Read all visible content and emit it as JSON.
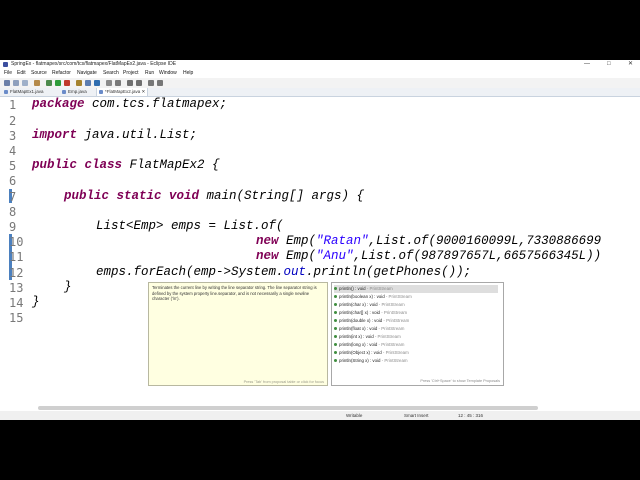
{
  "window": {
    "title": "SpringEx - flatmapex/src/com/tcs/flatmapex/FlatMapEx2.java - Eclipse IDE",
    "minimize": "—",
    "maximize": "□",
    "close": "✕"
  },
  "menu": [
    "File",
    "Edit",
    "Source",
    "Refactor",
    "Navigate",
    "Search",
    "Project",
    "Run",
    "Window",
    "Help"
  ],
  "tabs": [
    {
      "label": "FlatMapEx1.java",
      "active": false
    },
    {
      "label": "Emp.java",
      "active": false
    },
    {
      "label": "*FlatMapEx2.java ✕",
      "active": true
    }
  ],
  "code": {
    "line_numbers": [
      "1",
      "2",
      "3",
      "4",
      "5",
      "6",
      "7",
      "8",
      "9",
      "10",
      "11",
      "12",
      "13",
      "14",
      "15"
    ],
    "l1_kw": "package",
    "l1_rest": " com.tcs.flatmapex;",
    "l3_kw": "import",
    "l3_rest": " java.util.List;",
    "l5_kw": "public class",
    "l5_rest": " FlatMapEx2 {",
    "l7_kw": "public static void",
    "l7_rest": " main(String[] args) {",
    "l9": "List<Emp> emps = List.of(",
    "l10_kw": "new",
    "l10_a": " Emp(",
    "l10_str": "\"Ratan\"",
    "l10_b": ",List.of(9000160099L,7330886699",
    "l11_kw": "new",
    "l11_a": " Emp(",
    "l11_str": "\"Anu\"",
    "l11_b": ",List.of(987897657L,6657566345L))",
    "l12_a": "emps.forEach(emp->System.",
    "l12_fld": "out",
    "l12_b": ".println(getPhones());",
    "l13": "}",
    "l14": "}"
  },
  "javadoc": {
    "text": "Terminates the current line by writing the line separator string. The line separator string is defined by the system property line.separator, and is not necessarily a single newline character ('\\n').",
    "footer": "Press 'Tab' from proposal table or click for focus"
  },
  "proposals": {
    "items": [
      {
        "sig": "println() : void",
        "type": " - PrintStream"
      },
      {
        "sig": "println(boolean x) : void",
        "type": " - PrintStream"
      },
      {
        "sig": "println(char x) : void",
        "type": " - PrintStream"
      },
      {
        "sig": "println(char[] x) : void",
        "type": " - PrintStream"
      },
      {
        "sig": "println(double x) : void",
        "type": " - PrintStream"
      },
      {
        "sig": "println(float x) : void",
        "type": " - PrintStream"
      },
      {
        "sig": "println(int x) : void",
        "type": " - PrintStream"
      },
      {
        "sig": "println(long x) : void",
        "type": " - PrintStream"
      },
      {
        "sig": "println(Object x) : void",
        "type": " - PrintStream"
      },
      {
        "sig": "println(String x) : void",
        "type": " - PrintStream"
      }
    ],
    "footer": "Press 'Ctrl+Space' to show Template Proposals"
  },
  "status": {
    "mode": "Writable",
    "insert": "Smart Insert",
    "position": "12 : 45 : 316"
  },
  "colors": {
    "keyword": "#7f0055",
    "string": "#2a00ff",
    "field": "#0000c0",
    "line_number": "#787878",
    "javadoc_bg": "#ffffe1"
  }
}
